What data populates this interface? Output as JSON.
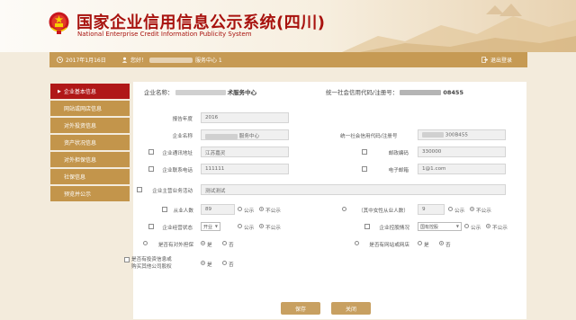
{
  "header": {
    "title_zh": "国家企业信用信息公示系统(四川)",
    "title_en": "National Enterprise Credit Information Publicity System"
  },
  "topbar": {
    "date": "2017年1月16日",
    "user_prefix": "您好！",
    "user_suffix": "服务中心 1",
    "logout": "退出登录"
  },
  "sidebar": {
    "items": [
      {
        "label": "企业基本信息",
        "active": true
      },
      {
        "label": "网站或网店信息",
        "active": false
      },
      {
        "label": "对外投资信息",
        "active": false
      },
      {
        "label": "资产状况信息",
        "active": false
      },
      {
        "label": "对外担保信息",
        "active": false
      },
      {
        "label": "社保信息",
        "active": false
      },
      {
        "label": "预览并公示",
        "active": false
      }
    ]
  },
  "main": {
    "company_name_label": "企业名称：",
    "company_name_suffix": "术服务中心",
    "credit_code_label": "统一社会信用代码/注册号：",
    "credit_code_suffix": "08455",
    "form": {
      "year_label": "报告年度",
      "year_value": "2016",
      "name_label": "企业名称",
      "name_value": "服务中心",
      "code_label": "统一社会信用代码/注册号",
      "code_value": "300B455",
      "address_label": "企业通讯地址",
      "address_value": "江苏嘉灵",
      "postal_label": "邮政编码",
      "postal_value": "330000",
      "phone_label": "企业联系电话",
      "phone_value": "111111",
      "email_label": "电子邮箱",
      "email_value": "1@1.com",
      "business_label": "企业主营业务活动",
      "business_value": "测试测试",
      "employees_label": "从业人数",
      "employees_value": "89",
      "female_label": "（其中女性从业人数）",
      "female_value": "9",
      "public_label": "公示",
      "nonpublic_label": "不公示",
      "status_label": "企业经营状态",
      "status_value": "开业",
      "holding_label": "企业控股情况",
      "holding_value": "国有控股",
      "guarantee_label": "是否有对外担保",
      "website_label": "是否有网站或网店",
      "equity_label_1": "是否有投资信息或",
      "equity_label_2": "购买其他公司股权",
      "yes_label": "是",
      "no_label": "否"
    },
    "save_button": "保存",
    "close_button": "关闭"
  },
  "colors": {
    "brand_red": "#a8120e",
    "gold": "#c69a54",
    "sidebar_active": "#b01818"
  }
}
